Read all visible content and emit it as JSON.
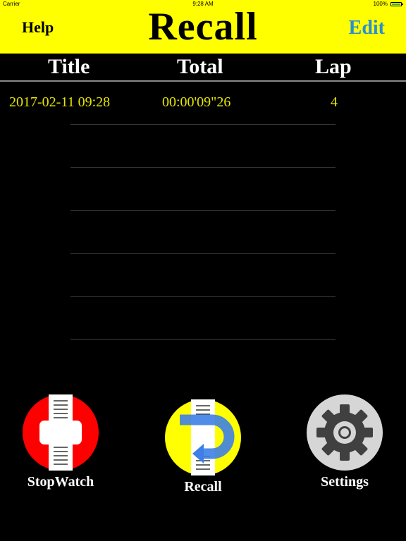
{
  "status_bar": {
    "carrier": "Carrier",
    "time": "9:28 AM",
    "battery": "100%"
  },
  "nav": {
    "left": "Help",
    "title": "Recall",
    "right": "Edit"
  },
  "table": {
    "headers": [
      "Title",
      "Total",
      "Lap"
    ],
    "rows": [
      {
        "title": "2017-02-11 09:28",
        "total": "00:00'09\"26",
        "lap": "4"
      }
    ]
  },
  "tabs": [
    {
      "label": "StopWatch",
      "icon": "stopwatch-icon"
    },
    {
      "label": "Recall",
      "icon": "recall-icon"
    },
    {
      "label": "Settings",
      "icon": "gear-icon"
    }
  ],
  "colors": {
    "bar": "#ffff00",
    "edit": "#2a8fd0",
    "row_text": "#e6e600",
    "stopwatch": "#ff0000",
    "recall_bg": "#ffff00",
    "recall_arrow": "#3d7fe6",
    "settings_bg": "#d6d6d6",
    "gear": "#404040"
  }
}
